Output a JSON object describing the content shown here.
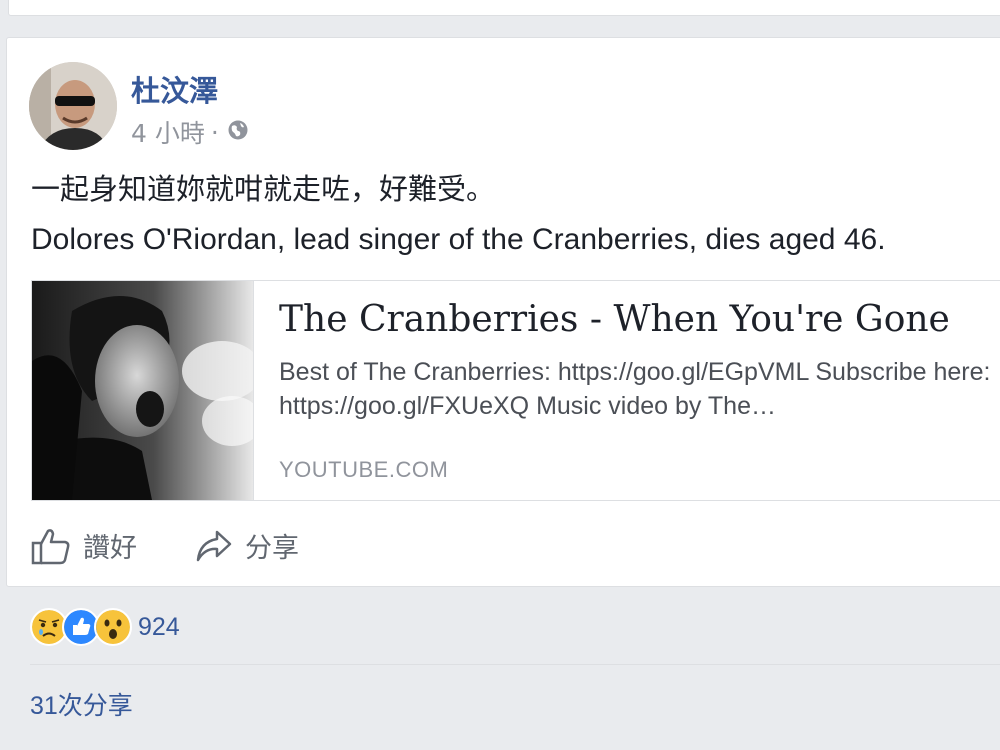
{
  "post": {
    "author": "杜汶澤",
    "time": "4 小時",
    "dot": "·",
    "text_line1": "一起身知道妳就咁就走咗，好難受。",
    "text_line2": "Dolores O'Riordan, lead singer of the Cranberries, dies aged 46."
  },
  "link_preview": {
    "title": "The Cranberries - When You're Gone",
    "description": "Best of The Cranberries: https://goo.gl/EGpVML Subscribe here: https://goo.gl/FXUeXQ Music video by The…",
    "domain": "YOUTUBE.COM"
  },
  "actions": {
    "like_label": "讚好",
    "share_label": "分享"
  },
  "reactions": {
    "icons": [
      "sad-icon",
      "like-icon",
      "wow-icon"
    ],
    "count": "924"
  },
  "shares": {
    "label": "31次分享"
  },
  "colors": {
    "link_blue": "#365899",
    "like_blue": "#2d88ff",
    "reaction_yellow": "#f7c33b",
    "muted_text": "#90949c"
  }
}
